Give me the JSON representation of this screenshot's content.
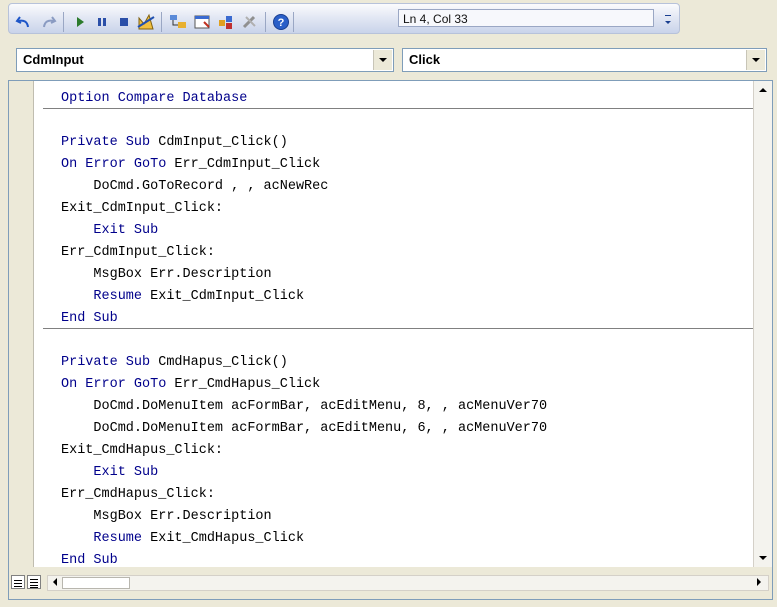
{
  "toolbar": {
    "buttons": [
      {
        "icon": "undo-icon"
      },
      {
        "icon": "redo-icon"
      },
      {
        "icon": "run-icon"
      },
      {
        "icon": "pause-icon"
      },
      {
        "icon": "stop-icon"
      },
      {
        "icon": "design-mode-icon"
      },
      {
        "icon": "project-explorer-icon"
      },
      {
        "icon": "properties-icon"
      },
      {
        "icon": "object-browser-icon"
      },
      {
        "icon": "toolbox-icon"
      },
      {
        "icon": "help-icon"
      }
    ],
    "cursor_position": "Ln 4, Col 33"
  },
  "object_combo": {
    "value": "CdmInput"
  },
  "procedure_combo": {
    "value": "Click"
  },
  "code": {
    "lines": [
      {
        "kw": "Option Compare Database",
        "rest": ""
      },
      {
        "kw": "",
        "rest": ""
      },
      {
        "kw": "Private Sub",
        "rest": " CdmInput_Click()"
      },
      {
        "kw": "On Error GoTo",
        "rest": " Err_CdmInput_Click"
      },
      {
        "kw": "",
        "rest": "    DoCmd.GoToRecord , , acNewRec"
      },
      {
        "kw": "",
        "rest": "Exit_CdmInput_Click:"
      },
      {
        "kw": "    Exit Sub",
        "rest": ""
      },
      {
        "kw": "",
        "rest": "Err_CdmInput_Click:"
      },
      {
        "kw": "",
        "rest": "    MsgBox Err.Description"
      },
      {
        "kw": "    Resume",
        "rest": " Exit_CdmInput_Click"
      },
      {
        "kw": "End Sub",
        "rest": ""
      },
      {
        "kw": "",
        "rest": ""
      },
      {
        "kw": "Private Sub",
        "rest": " CmdHapus_Click()"
      },
      {
        "kw": "On Error GoTo",
        "rest": " Err_CmdHapus_Click"
      },
      {
        "kw": "",
        "rest": "    DoCmd.DoMenuItem acFormBar, acEditMenu, 8, , acMenuVer70"
      },
      {
        "kw": "",
        "rest": "    DoCmd.DoMenuItem acFormBar, acEditMenu, 6, , acMenuVer70"
      },
      {
        "kw": "",
        "rest": "Exit_CmdHapus_Click:"
      },
      {
        "kw": "    Exit Sub",
        "rest": ""
      },
      {
        "kw": "",
        "rest": "Err_CmdHapus_Click:"
      },
      {
        "kw": "",
        "rest": "    MsgBox Err.Description"
      },
      {
        "kw": "    Resume",
        "rest": " Exit_CmdHapus_Click"
      },
      {
        "kw": "End Sub",
        "rest": ""
      }
    ]
  },
  "colors": {
    "keyword": "#00008b",
    "text": "#000000"
  }
}
